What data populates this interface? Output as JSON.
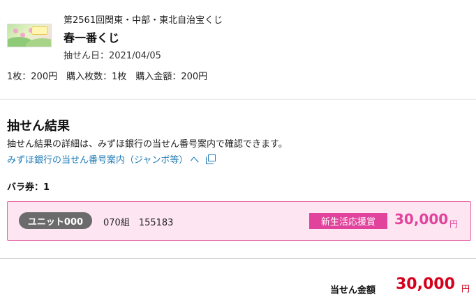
{
  "lottery": {
    "round": "第2561回関東・中部・東北自治宝くじ",
    "name": "春一番くじ",
    "draw_date": "抽せん日：2021/04/05",
    "purchase_info": "1枚：200円　購入枚数：1枚　購入金額：200円"
  },
  "results": {
    "title": "抽せん結果",
    "description": "抽せん結果の詳細は、みずほ銀行の当せん番号案内で確認できます。",
    "link_text": "みずほ銀行の当せん番号案内（ジャンボ等）",
    "link_chevron": "へ",
    "ticket_type": "バラ券：1"
  },
  "winning_ticket": {
    "unit": "ユニット000",
    "number": "070組　155183",
    "prize_name": "新生活応援賞",
    "amount": "30,000",
    "currency": "円"
  },
  "total": {
    "label": "当せん金額",
    "amount": "30,000",
    "currency": "円"
  },
  "colors": {
    "pink_accent": "#e1439c",
    "total_red": "#d6001c",
    "link_blue": "#1f7bb6",
    "box_bg": "#fde6f2"
  },
  "icons": {
    "external_link": "external-link-icon"
  }
}
